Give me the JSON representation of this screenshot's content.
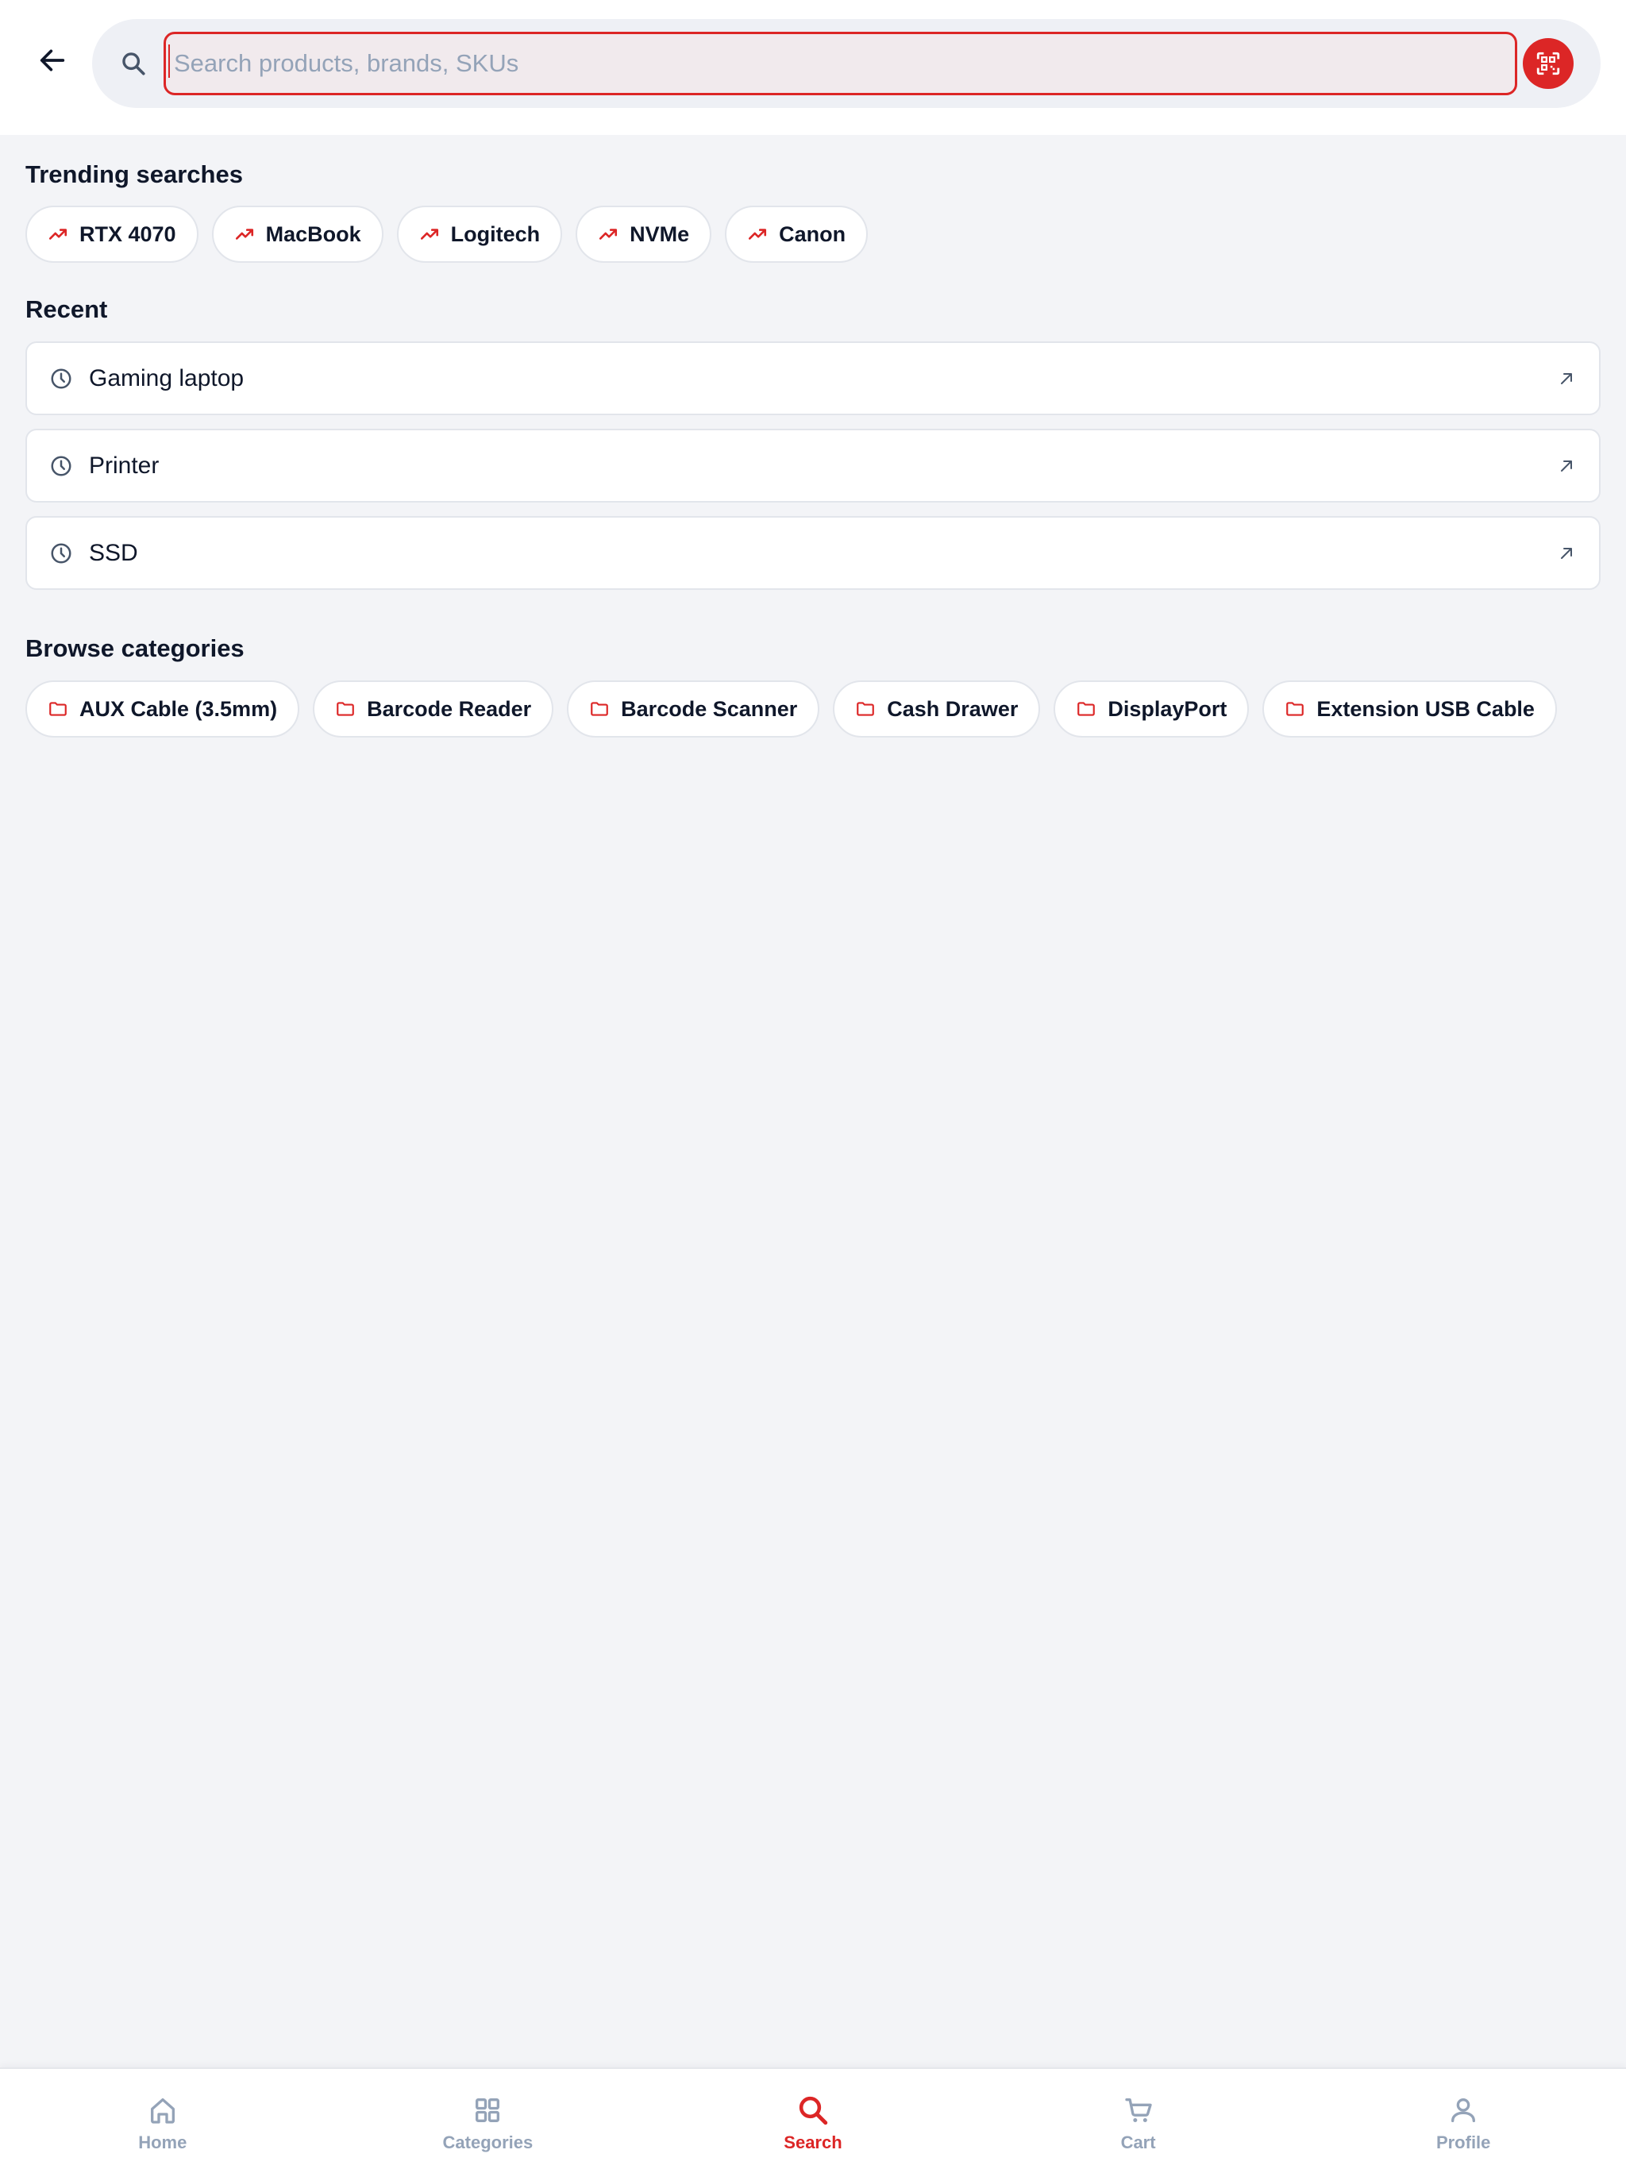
{
  "colors": {
    "accent": "#dc2626",
    "background": "#f3f4f7",
    "text": "#0f172a",
    "muted": "#94a3b8"
  },
  "header": {
    "back_icon": "arrow-left-icon",
    "search": {
      "icon": "search-icon",
      "placeholder": "Search products, brands, SKUs",
      "value": ""
    },
    "scan_icon": "qr-scan-icon"
  },
  "trending": {
    "title": "Trending searches",
    "icon": "trending-up-icon",
    "items": [
      "RTX 4070",
      "MacBook",
      "Logitech",
      "NVMe",
      "Canon"
    ]
  },
  "recent": {
    "title": "Recent",
    "icon": "clock-icon",
    "action_icon": "arrow-up-left-icon",
    "items": [
      "Gaming laptop",
      "Printer",
      "SSD"
    ]
  },
  "categories": {
    "title": "Browse categories",
    "icon": "folder-icon",
    "items": [
      "AUX Cable (3.5mm)",
      "Barcode Reader",
      "Barcode Scanner",
      "Cash Drawer",
      "DisplayPort",
      "Extension USB Cable"
    ]
  },
  "bottom_nav": {
    "active": "Search",
    "items": [
      {
        "label": "Home",
        "icon": "home-icon"
      },
      {
        "label": "Categories",
        "icon": "grid-icon"
      },
      {
        "label": "Search",
        "icon": "search-icon"
      },
      {
        "label": "Cart",
        "icon": "cart-icon"
      },
      {
        "label": "Profile",
        "icon": "user-icon"
      }
    ]
  }
}
